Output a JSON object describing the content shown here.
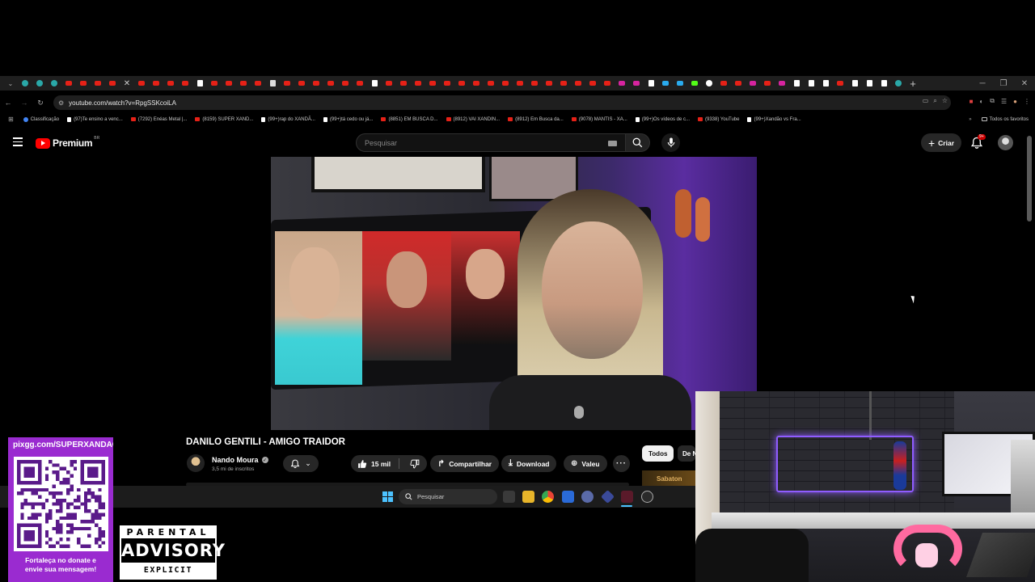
{
  "browser": {
    "url": "youtube.com/watch?v=RpgSSKcoiLA",
    "bookmarks": [
      {
        "label": "Classificação",
        "icon": "globe-icon"
      },
      {
        "label": "(97)Te ensino a venc...",
        "icon": "tiktok-icon"
      },
      {
        "label": "(7292) Enéas Metal |...",
        "icon": "youtube-icon"
      },
      {
        "label": "(8159) SUPER XAND...",
        "icon": "youtube-icon"
      },
      {
        "label": "(99+)rap do XANDÃ...",
        "icon": "tiktok-icon"
      },
      {
        "label": "(99+)tá cedo ou já...",
        "icon": "tiktok-icon"
      },
      {
        "label": "(8851) EM BUSCA D...",
        "icon": "youtube-icon"
      },
      {
        "label": "(8912) VAI XANDIN...",
        "icon": "youtube-icon"
      },
      {
        "label": "(8912) Em Busca da...",
        "icon": "youtube-icon"
      },
      {
        "label": "(9078) MANTIS - XA...",
        "icon": "youtube-icon"
      },
      {
        "label": "(99+)Os vídeos de c...",
        "icon": "tiktok-icon"
      },
      {
        "label": "(9338) YouTube",
        "icon": "youtube-icon"
      },
      {
        "label": "(99+)Xandão vs Fra...",
        "icon": "tiktok-icon"
      }
    ],
    "bookmarks_all": "Todos os favoritos"
  },
  "youtube": {
    "logo_text": "Premium",
    "country": "BR",
    "search_placeholder": "Pesquisar",
    "create_label": "Criar",
    "notif_badge": "9+",
    "video": {
      "title": "DANILO GENTILI - AMIGO TRAIDOR",
      "channel": "Nando Moura",
      "subscribers": "3,5 mi de inscritos",
      "likes": "15 mil",
      "share_label": "Compartilhar",
      "download_label": "Download",
      "thanks_label": "Valeu"
    },
    "chips": {
      "all": "Todos",
      "from": "De Nando Moura"
    },
    "reco_thumb_text": "Sabaton"
  },
  "taskbar": {
    "search_placeholder": "Pesquisar"
  },
  "overlay": {
    "qr_url": "pixgg.com/SUPERXANDAO",
    "qr_caption_line1": "Fortaleça no donate e",
    "qr_caption_line2": "envie sua mensagem!",
    "advisory_top": "PARENTAL",
    "advisory_mid": "ADVISORY",
    "advisory_bot": "EXPLICIT CONTENT"
  },
  "colors": {
    "yt_red": "#ff0000",
    "qr_panel": "#9a2bd0",
    "taskbar_accent": "#4cc2ff"
  }
}
